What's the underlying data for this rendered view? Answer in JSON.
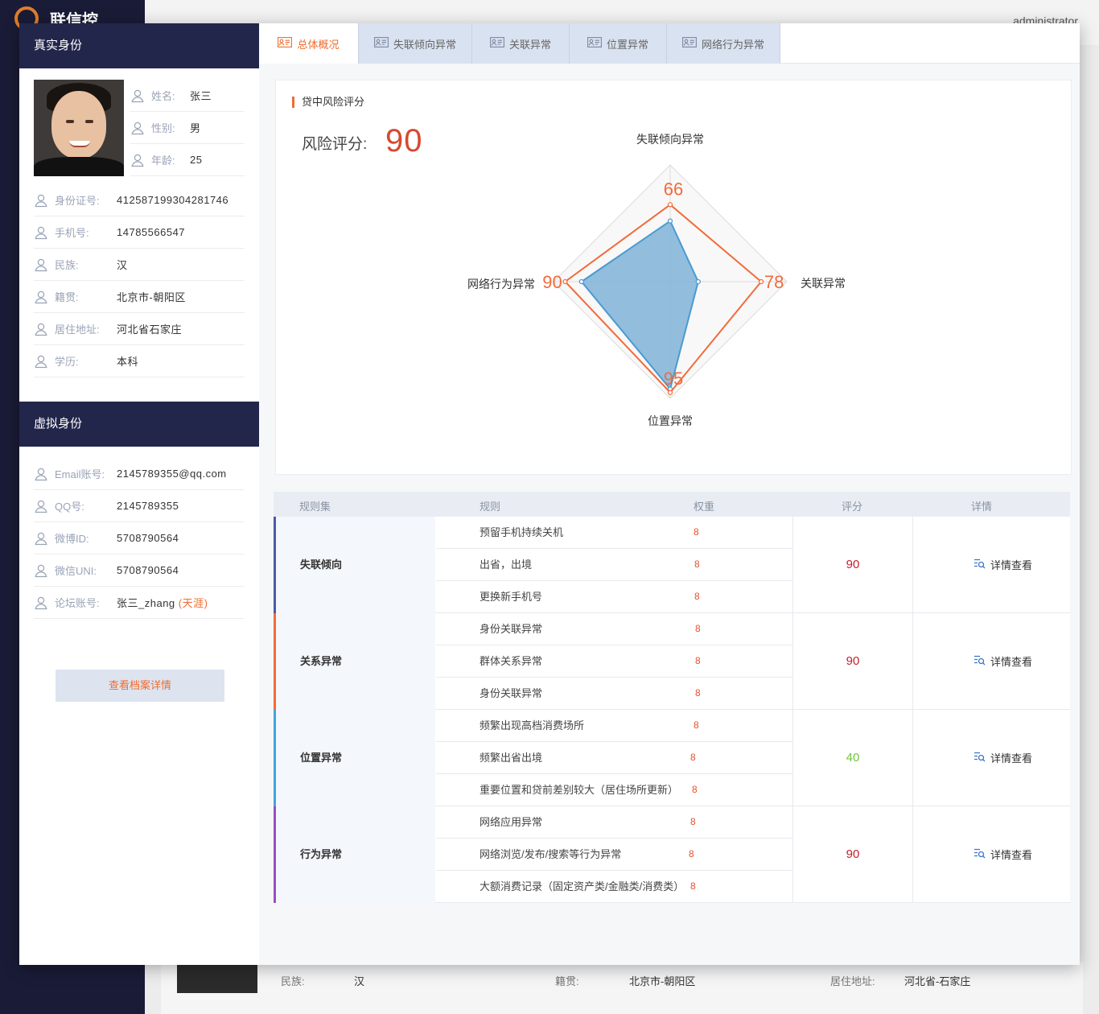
{
  "background": {
    "app_name": "联信控",
    "user": "administrator",
    "strip": {
      "ethnicity_label": "民族:",
      "ethnicity_value": "汉",
      "native_label": "籍贯:",
      "native_value": "北京市-朝阳区",
      "address_label": "居住地址:",
      "address_value": "河北省-石家庄"
    }
  },
  "real_identity": {
    "title": "真实身份",
    "top_fields": [
      {
        "label": "姓名:",
        "value": "张三"
      },
      {
        "label": "性别:",
        "value": "男"
      },
      {
        "label": "年龄:",
        "value": "25"
      }
    ],
    "fields": [
      {
        "label": "身份证号:",
        "value": "412587199304281746"
      },
      {
        "label": "手机号:",
        "value": "14785566547"
      },
      {
        "label": "民族:",
        "value": "汉"
      },
      {
        "label": "籍贯:",
        "value": "北京市-朝阳区"
      },
      {
        "label": "居住地址:",
        "value": "河北省石家庄"
      },
      {
        "label": "学历:",
        "value": "本科"
      }
    ]
  },
  "virtual_identity": {
    "title": "虚拟身份",
    "fields": [
      {
        "label": "Email账号:",
        "value": "2145789355@qq.com"
      },
      {
        "label": "QQ号:",
        "value": "2145789355"
      },
      {
        "label": "微博ID:",
        "value": "5708790564"
      },
      {
        "label": "微信UNI:",
        "value": "5708790564"
      },
      {
        "label": "论坛账号:",
        "value": "张三_zhang",
        "tag": "(天涯)"
      }
    ],
    "archive_button": "查看档案详情"
  },
  "tabs": [
    {
      "label": "总体概况",
      "active": true
    },
    {
      "label": "失联倾向异常",
      "active": false
    },
    {
      "label": "关联异常",
      "active": false
    },
    {
      "label": "位置异常",
      "active": false
    },
    {
      "label": "网络行为异常",
      "active": false
    }
  ],
  "score_card": {
    "section_title": "贷中风险评分",
    "risk_label": "风险评分:",
    "risk_value": "90"
  },
  "chart_data": {
    "type": "radar",
    "axes": [
      "失联倾向异常",
      "关联异常",
      "位置异常",
      "网络行为异常"
    ],
    "max": 100,
    "series": [
      {
        "values": [
          66,
          78,
          95,
          90
        ],
        "color": "#f26b3a",
        "labels_shown": true
      },
      {
        "values": [
          52,
          24,
          92,
          76
        ],
        "color": "#4a9ad1",
        "fill": "#86b6d9",
        "labels_shown": false
      }
    ],
    "value_label_color": "#f26b3a"
  },
  "rules_table": {
    "headers": {
      "set": "规则集",
      "rule": "规则",
      "weight": "权重",
      "score": "评分",
      "detail": "详情"
    },
    "detail_label": "详情查看",
    "groups": [
      {
        "name": "失联倾向",
        "color": "#4a5aa8",
        "score": "90",
        "rules": [
          {
            "name": "预留手机持续关机",
            "weight": "8"
          },
          {
            "name": "出省，出境",
            "weight": "8"
          },
          {
            "name": "更换新手机号",
            "weight": "8"
          }
        ]
      },
      {
        "name": "关系异常",
        "color": "#f26b3a",
        "score": "90",
        "rules": [
          {
            "name": "身份关联异常",
            "weight": "8"
          },
          {
            "name": "群体关系异常",
            "weight": "8"
          },
          {
            "name": "身份关联异常",
            "weight": "8"
          }
        ]
      },
      {
        "name": "位置异常",
        "color": "#3fa4e0",
        "score": "40",
        "rules": [
          {
            "name": "频繁出现高档消费场所",
            "weight": "8"
          },
          {
            "name": "频繁出省出境",
            "weight": "8"
          },
          {
            "name": "重要位置和贷前差别较大（居住场所更新）",
            "weight": "8"
          }
        ]
      },
      {
        "name": "行为异常",
        "color": "#9a4fc0",
        "score": "90",
        "rules": [
          {
            "name": "网络应用异常",
            "weight": "8"
          },
          {
            "name": "网络浏览/发布/搜索等行为异常",
            "weight": "8"
          },
          {
            "name": "大额消费记录（固定资产类/金融类/消费类）",
            "weight": "8"
          }
        ]
      }
    ]
  }
}
